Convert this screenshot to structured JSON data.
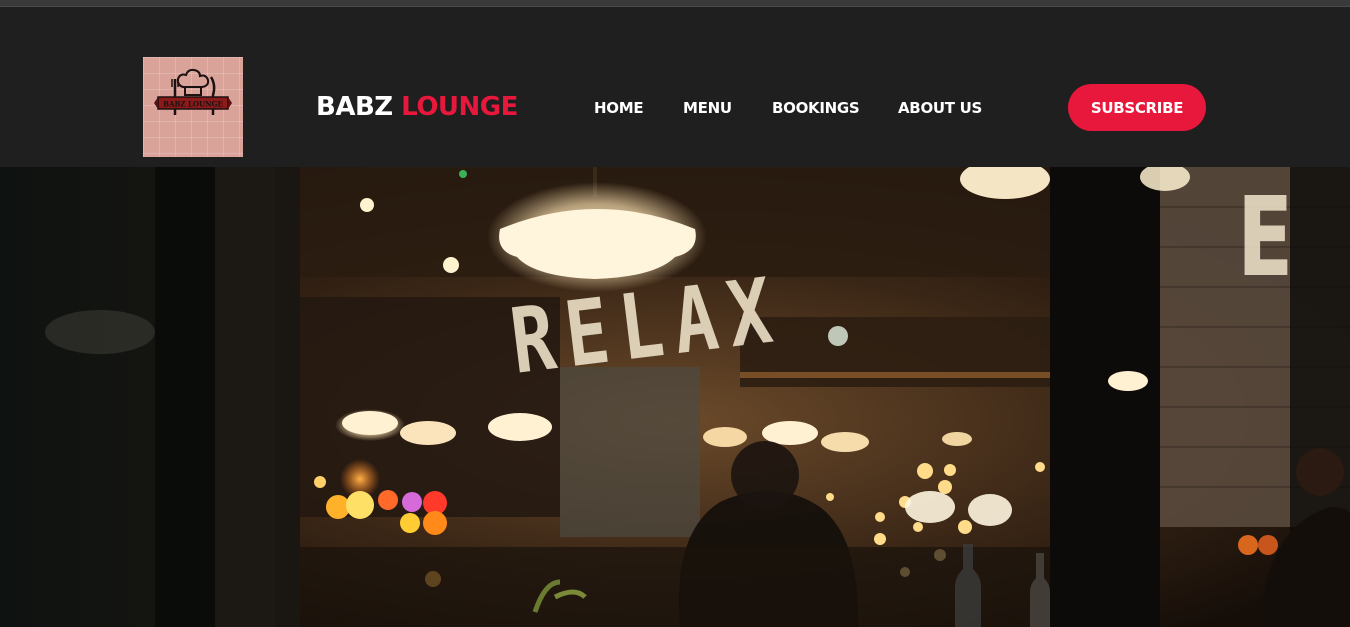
{
  "brand": {
    "name_part1": "BABZ",
    "name_part2": "LOUNGE",
    "accent_color": "#e8173c",
    "logo_text": "BABZ LOUNGE"
  },
  "nav": {
    "items": [
      {
        "label": "HOME"
      },
      {
        "label": "MENU"
      },
      {
        "label": "BOOKINGS"
      },
      {
        "label": "ABOUT US"
      }
    ]
  },
  "header": {
    "subscribe_label": "SUBSCRIBE"
  },
  "hero": {
    "sign_text": "RELAX",
    "edge_letter": "E"
  }
}
